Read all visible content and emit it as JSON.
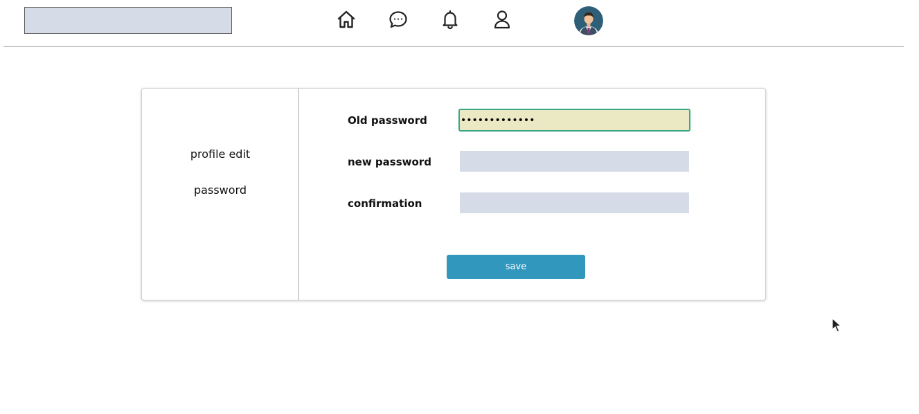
{
  "header": {
    "search": {
      "value": "",
      "placeholder": ""
    },
    "icons": [
      "home-icon",
      "chat-icon",
      "bell-icon",
      "user-icon"
    ]
  },
  "sidebar": {
    "items": [
      {
        "label": "profile edit"
      },
      {
        "label": "password"
      }
    ]
  },
  "form": {
    "old_password": {
      "label": "Old password",
      "value": "•••••••••••••"
    },
    "new_password": {
      "label": "new password",
      "value": ""
    },
    "confirmation": {
      "label": "confirmation",
      "value": ""
    },
    "save_label": "save"
  },
  "colors": {
    "input_bg": "#d5dce8",
    "focused_bg": "#ebe9c3",
    "focus_border": "#3aa788",
    "button_bg": "#3297bd"
  }
}
